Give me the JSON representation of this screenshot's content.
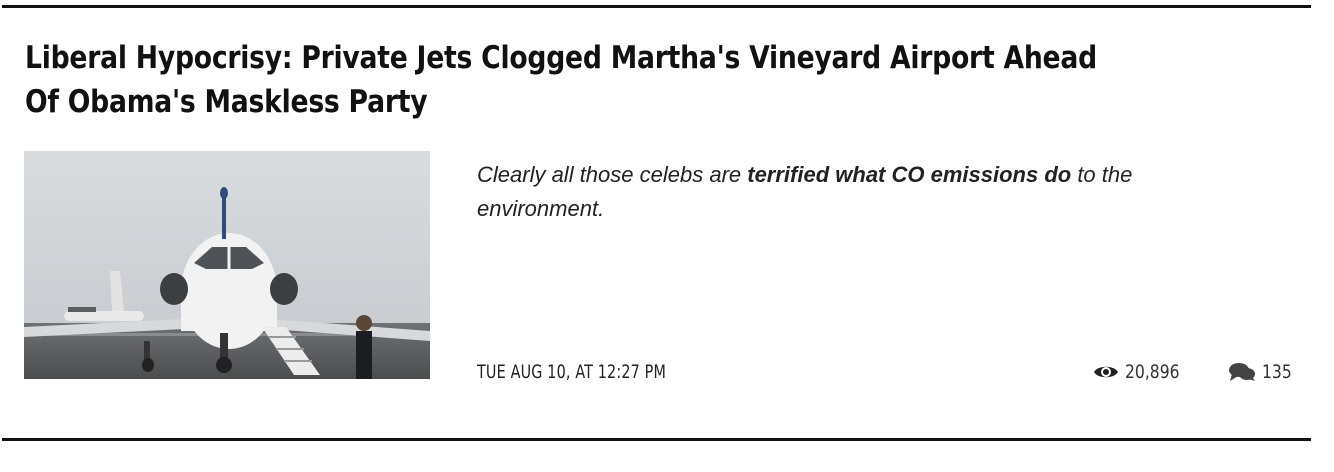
{
  "article": {
    "title": "Liberal Hypocrisy: Private Jets Clogged Martha's Vineyard Airport Ahead Of Obama's Maskless Party",
    "thumbnail_icon": "private-jet-photo",
    "excerpt": {
      "lead": "Clearly all those celebs are ",
      "emphasis": "terrified what CO emissions do",
      "tail": " to the environment."
    },
    "date": "TUE AUG 10, AT 12:27 PM",
    "views": "20,896",
    "views_icon": "eye-icon",
    "comments": "135",
    "comments_icon": "speech-bubbles-icon"
  }
}
